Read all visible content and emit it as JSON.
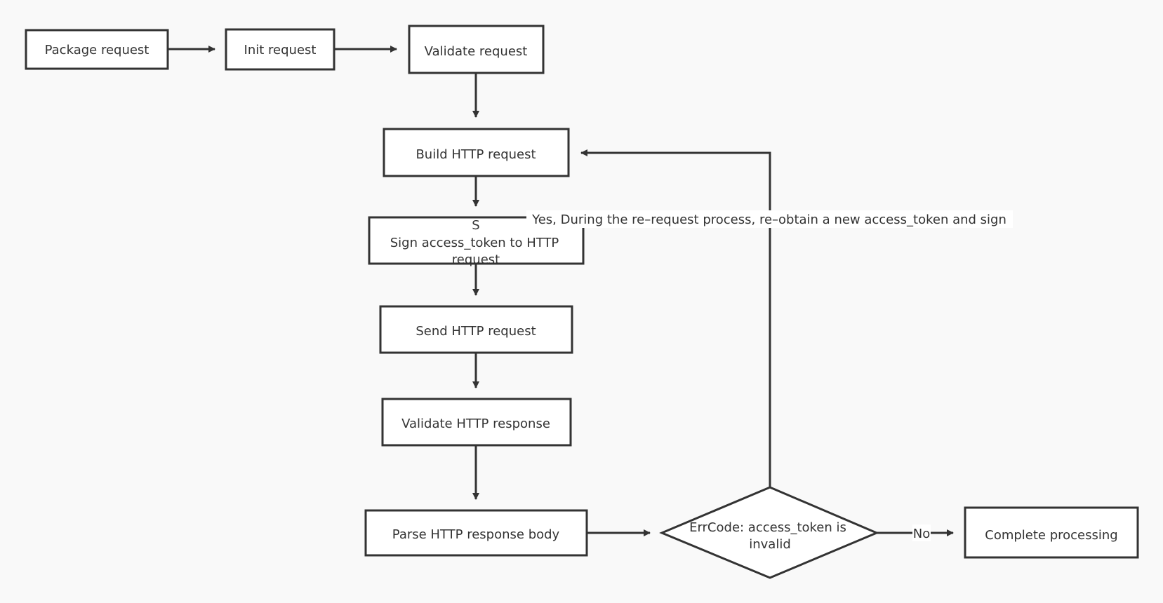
{
  "diagram": {
    "type": "flowchart",
    "colors": {
      "background": "#f9f9f9",
      "node_fill": "#ffffff",
      "stroke": "#333333",
      "text": "#333333",
      "label_bg": "#ffffff"
    },
    "nodes": {
      "package": {
        "label": "Package request"
      },
      "init": {
        "label": "Init request"
      },
      "validate": {
        "label": "Validate request"
      },
      "build": {
        "label": "Build HTTP request"
      },
      "sign": {
        "label_line1": "S",
        "label_line2": "Sign access_token to HTTP",
        "label_line3": "request"
      },
      "send": {
        "label": "Send HTTP request"
      },
      "validate_resp": {
        "label": "Validate HTTP response"
      },
      "parse": {
        "label": "Parse HTTP response body"
      },
      "decision": {
        "label_line1": "ErrCode: access_token is",
        "label_line2": "invalid"
      },
      "complete": {
        "label": "Complete processing"
      }
    },
    "edges": [
      {
        "from": "package",
        "to": "init"
      },
      {
        "from": "init",
        "to": "validate"
      },
      {
        "from": "validate",
        "to": "build"
      },
      {
        "from": "build",
        "to": "sign"
      },
      {
        "from": "sign",
        "to": "send"
      },
      {
        "from": "send",
        "to": "validate_resp"
      },
      {
        "from": "validate_resp",
        "to": "parse"
      },
      {
        "from": "parse",
        "to": "decision"
      },
      {
        "from": "decision",
        "to": "build",
        "label": "Yes, During the re–request process, re–obtain a new access_token and sign"
      },
      {
        "from": "decision",
        "to": "complete",
        "label": "No"
      }
    ]
  }
}
